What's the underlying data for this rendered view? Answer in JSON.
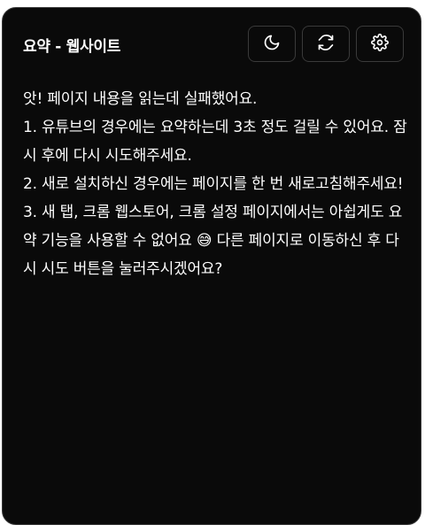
{
  "header": {
    "title": "요약 - 웹사이트",
    "buttons": [
      {
        "icon": "moon-icon",
        "label": "theme"
      },
      {
        "icon": "refresh-icon",
        "label": "refresh"
      },
      {
        "icon": "gear-icon",
        "label": "settings"
      }
    ]
  },
  "message": {
    "lines": [
      "앗! 페이지 내용을 읽는데 실패했어요.",
      "1. 유튜브의 경우에는 요약하는데 3초 정도 걸릴 수 있어요. 잠시 후에 다시 시도해주세요.",
      "2. 새로 설치하신 경우에는 페이지를 한 번 새로고침해주세요!",
      "3. 새 탭, 크롬 웹스토어, 크롬 설정 페이지에서는 아쉽게도 요약 기능을 사용할 수 없어요 😅 다른 페이지로 이동하신 후 다시 시도 버튼을 눌러주시겠어요?"
    ]
  }
}
